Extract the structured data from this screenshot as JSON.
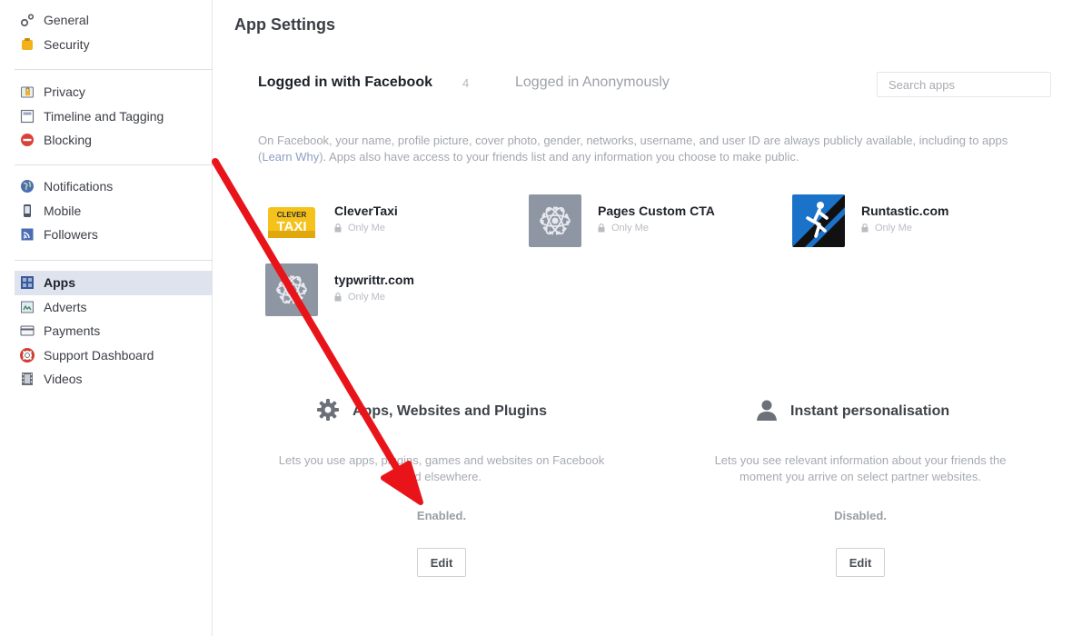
{
  "sidebar": {
    "groups": [
      [
        {
          "label": "General",
          "icon": "gear-icon"
        },
        {
          "label": "Security",
          "icon": "badge-icon"
        }
      ],
      [
        {
          "label": "Privacy",
          "icon": "lock-icon"
        },
        {
          "label": "Timeline and Tagging",
          "icon": "timeline-icon"
        },
        {
          "label": "Blocking",
          "icon": "block-icon"
        }
      ],
      [
        {
          "label": "Notifications",
          "icon": "globe-icon"
        },
        {
          "label": "Mobile",
          "icon": "mobile-icon"
        },
        {
          "label": "Followers",
          "icon": "rss-icon"
        }
      ],
      [
        {
          "label": "Apps",
          "icon": "apps-icon",
          "selected": true
        },
        {
          "label": "Adverts",
          "icon": "adverts-icon"
        },
        {
          "label": "Payments",
          "icon": "card-icon"
        },
        {
          "label": "Support Dashboard",
          "icon": "lifebuoy-icon"
        },
        {
          "label": "Videos",
          "icon": "film-icon"
        }
      ]
    ]
  },
  "main": {
    "title": "App Settings",
    "tabs": {
      "active_label": "Logged in with Facebook",
      "active_count": "4",
      "inactive_label": "Logged in Anonymously"
    },
    "search": {
      "placeholder": "Search apps"
    },
    "info": {
      "text_before": "On Facebook, your name, profile picture, cover photo, gender, networks, username, and user ID are always publicly available, including to apps (",
      "link": "Learn Why",
      "text_after": "). Apps also have access to your friends list and any information you choose to make public."
    },
    "apps": [
      {
        "name": "CleverTaxi",
        "privacy": "Only Me",
        "logo_line1": "CLEVER",
        "logo_line2": "TAXI"
      },
      {
        "name": "Pages Custom CTA",
        "privacy": "Only Me"
      },
      {
        "name": "Runtastic.com",
        "privacy": "Only Me"
      },
      {
        "name": "typwrittr.com",
        "privacy": "Only Me"
      }
    ],
    "sections": {
      "plugins": {
        "title": "Apps, Websites and Plugins",
        "description": "Lets you use apps, plugins, games and websites on Facebook and elsewhere.",
        "status": "Enabled.",
        "button": "Edit"
      },
      "personalisation": {
        "title": "Instant personalisation",
        "description": "Lets you see relevant information about your friends the moment you arrive on select partner websites.",
        "status": "Disabled.",
        "button": "Edit"
      }
    }
  },
  "colors": {
    "selected_nav_bg": "#dfe3ee",
    "annotation_arrow": "#e8141a",
    "runtastic_blue": "#1b73c9",
    "gear_tile": "#8f96a3",
    "taxi_yellow": "#f4c21b"
  }
}
